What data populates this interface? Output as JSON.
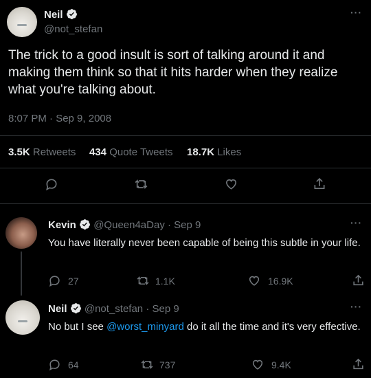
{
  "main_tweet": {
    "name": "Neil",
    "handle": "@not_stefan",
    "text": "The trick to a good insult is sort of talking around it and making them think so that it hits harder when they realize what you're talking about.",
    "timestamp": "8:07 PM · Sep 9, 2008",
    "stats": {
      "retweets_count": "3.5K",
      "retweets_label": "Retweets",
      "quotes_count": "434",
      "quotes_label": "Quote Tweets",
      "likes_count": "18.7K",
      "likes_label": "Likes"
    },
    "more": "···"
  },
  "replies": [
    {
      "name": "Kevin",
      "handle": "@Queen4aDay",
      "date": "· Sep 9",
      "text": "You have literally never been capable of being this subtle in your life.",
      "reply_count": "27",
      "retweet_count": "1.1K",
      "like_count": "16.9K",
      "more": "···"
    },
    {
      "name": "Neil",
      "handle": "@not_stefan",
      "date": "· Sep 9",
      "text_before": "No but I see ",
      "mention": "@worst_minyard",
      "text_after": " do it all the time and it's very effective.",
      "reply_count": "64",
      "retweet_count": "737",
      "like_count": "9.4K",
      "more": "···"
    }
  ],
  "colors": {
    "background": "#000000",
    "text": "#e7e9ea",
    "muted": "#71767b",
    "link": "#1d9bf0",
    "verified": "#1d9bf0",
    "divider": "#2f3336"
  }
}
